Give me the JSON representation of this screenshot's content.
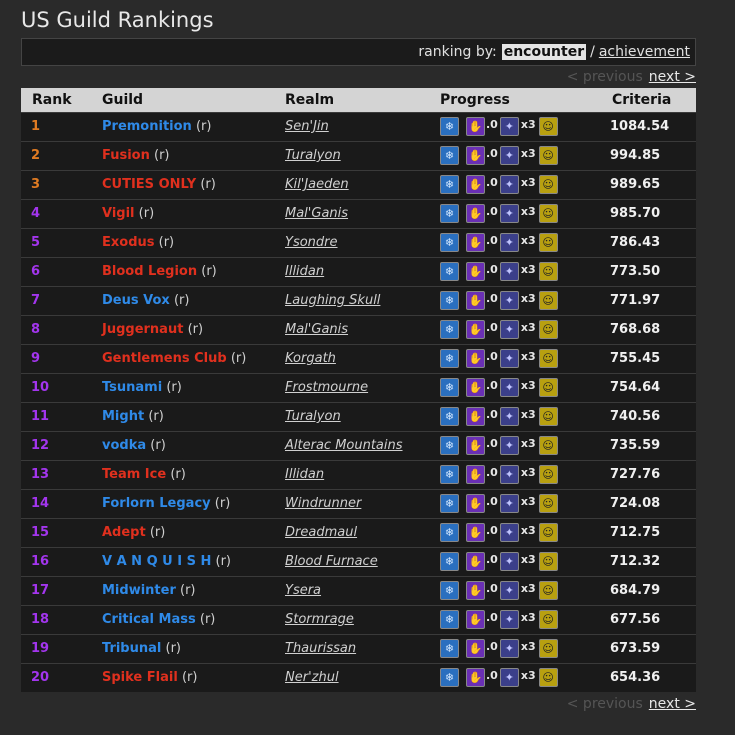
{
  "page": {
    "title": "US Guild Rankings"
  },
  "ranking_by": {
    "label": "ranking by:",
    "selected": "encounter",
    "separator": "/",
    "other": "achievement"
  },
  "pager": {
    "previous": "< previous",
    "next": "next >"
  },
  "table": {
    "headers": [
      "Rank",
      "Guild",
      "Realm",
      "Progress",
      "Criteria"
    ],
    "progress": {
      "icon1": "frost-boss-icon",
      "icon2": "arcane-boss-icon",
      "icon2_suffix": ".0",
      "icon3": "shadow-boss-icon",
      "icon3_suffix": "x3",
      "icon4": "achievement-face-icon"
    },
    "colors": {
      "orange": "#e07b22",
      "purple": "#a335ee",
      "red": "#e0301e",
      "blue": "#2f8ae8"
    },
    "rows": [
      {
        "rank": "1",
        "rank_color": "#e07b22",
        "guild": "Premonition",
        "guild_color": "#2f8ae8",
        "r": "(r)",
        "realm": "Sen'Jin",
        "criteria": "1084.54"
      },
      {
        "rank": "2",
        "rank_color": "#e07b22",
        "guild": "Fusion",
        "guild_color": "#e0301e",
        "r": "(r)",
        "realm": "Turalyon",
        "criteria": "994.85"
      },
      {
        "rank": "3",
        "rank_color": "#e07b22",
        "guild": "CUTIES ONLY",
        "guild_color": "#e0301e",
        "r": "(r)",
        "realm": "Kil'Jaeden",
        "criteria": "989.65"
      },
      {
        "rank": "4",
        "rank_color": "#a335ee",
        "guild": "Vigil",
        "guild_color": "#e0301e",
        "r": "(r)",
        "realm": "Mal'Ganis",
        "criteria": "985.70"
      },
      {
        "rank": "5",
        "rank_color": "#a335ee",
        "guild": "Exodus",
        "guild_color": "#e0301e",
        "r": "(r)",
        "realm": "Ysondre",
        "criteria": "786.43"
      },
      {
        "rank": "6",
        "rank_color": "#a335ee",
        "guild": "Blood Legion",
        "guild_color": "#e0301e",
        "r": "(r)",
        "realm": "Illidan",
        "criteria": "773.50"
      },
      {
        "rank": "7",
        "rank_color": "#a335ee",
        "guild": "Deus Vox",
        "guild_color": "#2f8ae8",
        "r": "(r)",
        "realm": "Laughing Skull",
        "criteria": "771.97"
      },
      {
        "rank": "8",
        "rank_color": "#a335ee",
        "guild": "Juggernaut",
        "guild_color": "#e0301e",
        "r": "(r)",
        "realm": "Mal'Ganis",
        "criteria": "768.68"
      },
      {
        "rank": "9",
        "rank_color": "#a335ee",
        "guild": "Gentlemens Club",
        "guild_color": "#e0301e",
        "r": "(r)",
        "realm": "Korgath",
        "criteria": "755.45"
      },
      {
        "rank": "10",
        "rank_color": "#a335ee",
        "guild": "Tsunami",
        "guild_color": "#2f8ae8",
        "r": "(r)",
        "realm": "Frostmourne",
        "criteria": "754.64"
      },
      {
        "rank": "11",
        "rank_color": "#a335ee",
        "guild": "Might",
        "guild_color": "#2f8ae8",
        "r": "(r)",
        "realm": "Turalyon",
        "criteria": "740.56"
      },
      {
        "rank": "12",
        "rank_color": "#a335ee",
        "guild": "vodka",
        "guild_color": "#2f8ae8",
        "r": "(r)",
        "realm": "Alterac Mountains",
        "criteria": "735.59"
      },
      {
        "rank": "13",
        "rank_color": "#a335ee",
        "guild": "Team Ice",
        "guild_color": "#e0301e",
        "r": "(r)",
        "realm": "Illidan",
        "criteria": "727.76"
      },
      {
        "rank": "14",
        "rank_color": "#a335ee",
        "guild": "Forlorn Legacy",
        "guild_color": "#2f8ae8",
        "r": "(r)",
        "realm": "Windrunner",
        "criteria": "724.08"
      },
      {
        "rank": "15",
        "rank_color": "#a335ee",
        "guild": "Adept",
        "guild_color": "#e0301e",
        "r": "(r)",
        "realm": "Dreadmaul",
        "criteria": "712.75"
      },
      {
        "rank": "16",
        "rank_color": "#a335ee",
        "guild": "V A N Q U I S H",
        "guild_color": "#2f8ae8",
        "r": "(r)",
        "realm": "Blood Furnace",
        "criteria": "712.32"
      },
      {
        "rank": "17",
        "rank_color": "#a335ee",
        "guild": "Midwinter",
        "guild_color": "#2f8ae8",
        "r": "(r)",
        "realm": "Ysera",
        "criteria": "684.79"
      },
      {
        "rank": "18",
        "rank_color": "#a335ee",
        "guild": "Critical Mass",
        "guild_color": "#2f8ae8",
        "r": "(r)",
        "realm": "Stormrage",
        "criteria": "677.56"
      },
      {
        "rank": "19",
        "rank_color": "#a335ee",
        "guild": "Tribunal",
        "guild_color": "#2f8ae8",
        "r": "(r)",
        "realm": "Thaurissan",
        "criteria": "673.59"
      },
      {
        "rank": "20",
        "rank_color": "#a335ee",
        "guild": "Spike Flail",
        "guild_color": "#e0301e",
        "r": "(r)",
        "realm": "Ner'zhul",
        "criteria": "654.36"
      }
    ]
  }
}
